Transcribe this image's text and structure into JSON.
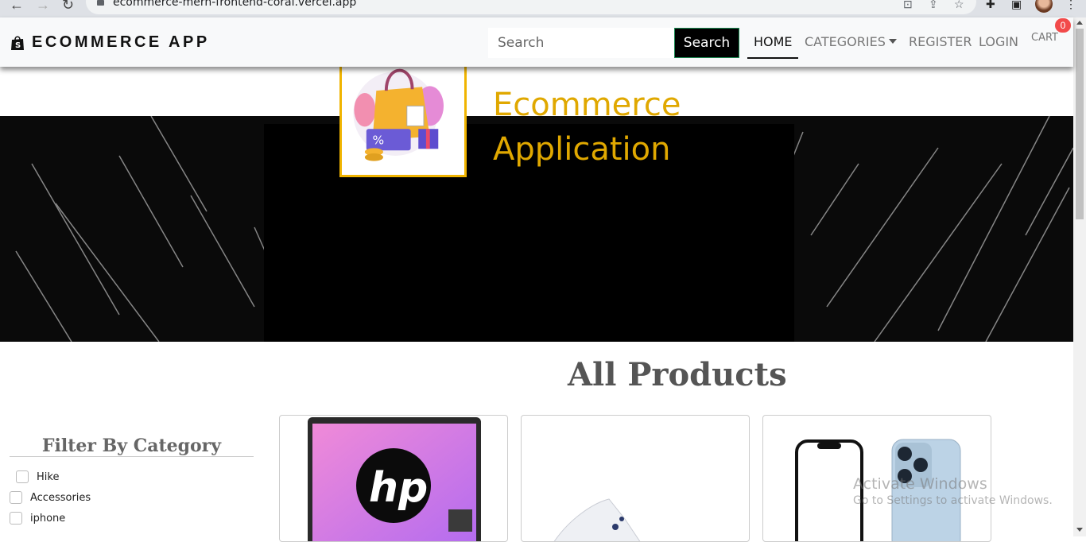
{
  "browser": {
    "url": "ecommerce-mern-frontend-coral.vercel.app"
  },
  "navbar": {
    "brand": "ECOMMERCE APP",
    "search_placeholder": "Search",
    "search_button": "Search",
    "links": {
      "home": "HOME",
      "categories": "CATEGORIES",
      "register": "REGISTER",
      "login": "LOGIN",
      "cart": "CART"
    },
    "cart_count": "0"
  },
  "banner": {
    "line1": "Ecommerce",
    "line2": "Application"
  },
  "products": {
    "title": "All Products"
  },
  "filter": {
    "title": "Filter By Category",
    "categories": [
      "Hike",
      "Accessories",
      "iphone"
    ]
  },
  "watermark": {
    "line1": "Activate Windows",
    "line2": "Go to Settings to activate Windows."
  },
  "colors": {
    "accent_gold": "#e0a800",
    "badge_red": "#f24a4a"
  }
}
